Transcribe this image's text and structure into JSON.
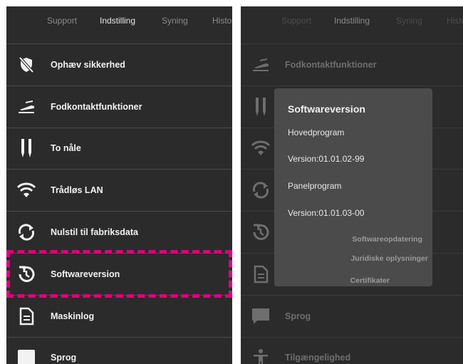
{
  "left": {
    "tabs": [
      "Support",
      "Indstilling",
      "Syning",
      "Histo"
    ],
    "active_tab": 1,
    "items": [
      {
        "icon": "security-off-icon",
        "label": "Ophæv sikkerhed"
      },
      {
        "icon": "foot-control-icon",
        "label": "Fodkontaktfunktioner"
      },
      {
        "icon": "twin-needle-icon",
        "label": "To nåle"
      },
      {
        "icon": "wifi-icon",
        "label": "Trådløs LAN"
      },
      {
        "icon": "factory-reset-icon",
        "label": "Nulstil til fabriksdata"
      },
      {
        "icon": "software-version-icon",
        "label": "Softwareversion"
      },
      {
        "icon": "document-icon",
        "label": "Maskinlog"
      },
      {
        "icon": "language-icon",
        "label": "Sprog"
      }
    ],
    "highlighted_item": "Softwareversion"
  },
  "right": {
    "tabs": [
      "Support",
      "Indstilling",
      "Syning",
      "Histo"
    ],
    "active_tab": 1,
    "items": [
      {
        "icon": "foot-control-icon",
        "label": "Fodkontaktfunktioner"
      },
      {
        "icon": "twin-needle-icon",
        "label": ""
      },
      {
        "icon": "wifi-icon",
        "label": ""
      },
      {
        "icon": "factory-reset-icon",
        "label": ""
      },
      {
        "icon": "software-version-icon",
        "label": ""
      },
      {
        "icon": "document-icon",
        "label": ""
      },
      {
        "icon": "language-icon",
        "label": "Sprog"
      },
      {
        "icon": "accessibility-icon",
        "label": "Tilgængelighed"
      }
    ]
  },
  "dialog": {
    "title": "Softwareversion",
    "main_program_label": "Hovedprogram",
    "main_program_version": "Version:01.01.02-99",
    "panel_program_label": "Panelprogram",
    "panel_program_version": "Version:01.01.03-00",
    "links": [
      "Softwareopdatering",
      "Juridiske oplysninger",
      "Certifikater"
    ]
  },
  "colors": {
    "background": "#2b2b2b",
    "highlight": "#e0007a",
    "dialog": "#4b4b4b"
  }
}
